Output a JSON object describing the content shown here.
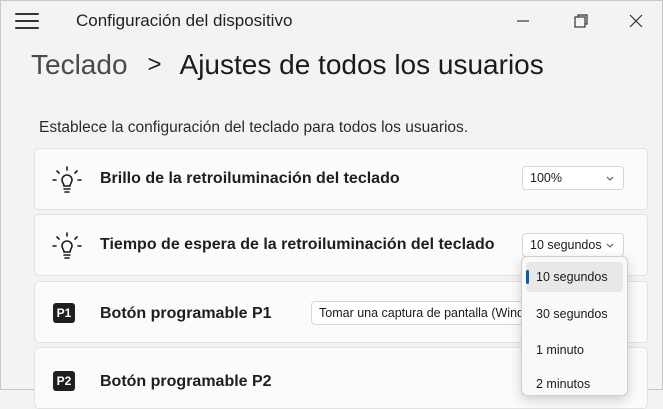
{
  "window": {
    "title": "Configuración del dispositivo",
    "icons": {
      "menu": "hamburger-icon",
      "minimize": "minimize-icon",
      "maximize": "maximize-icon",
      "close": "close-icon"
    }
  },
  "breadcrumb": {
    "parent": "Teclado",
    "separator": ">",
    "current": "Ajustes de todos los usuarios"
  },
  "description": "Establece la configuración del teclado para todos los usuarios.",
  "settings": [
    {
      "icon": "lightbulb-icon",
      "label": "Brillo de la retroiluminación del teclado",
      "value": "100%"
    },
    {
      "icon": "lightbulb-icon",
      "label": "Tiempo de espera de la retroiluminación del teclado",
      "value": "10 segundos"
    },
    {
      "icon": "p1-key-icon",
      "badge": "P1",
      "label": "Botón programable P1",
      "value": "Tomar una captura de pantalla (Windows"
    },
    {
      "icon": "p2-key-icon",
      "badge": "P2",
      "label": "Botón programable P2"
    }
  ],
  "dropdown": {
    "options": [
      "10 segundos",
      "30 segundos",
      "1 minuto",
      "2 minutos"
    ],
    "selected_index": 0
  },
  "colors": {
    "accent": "#005fb8",
    "background": "#f3f3f3",
    "card": "#fbfbfb"
  }
}
